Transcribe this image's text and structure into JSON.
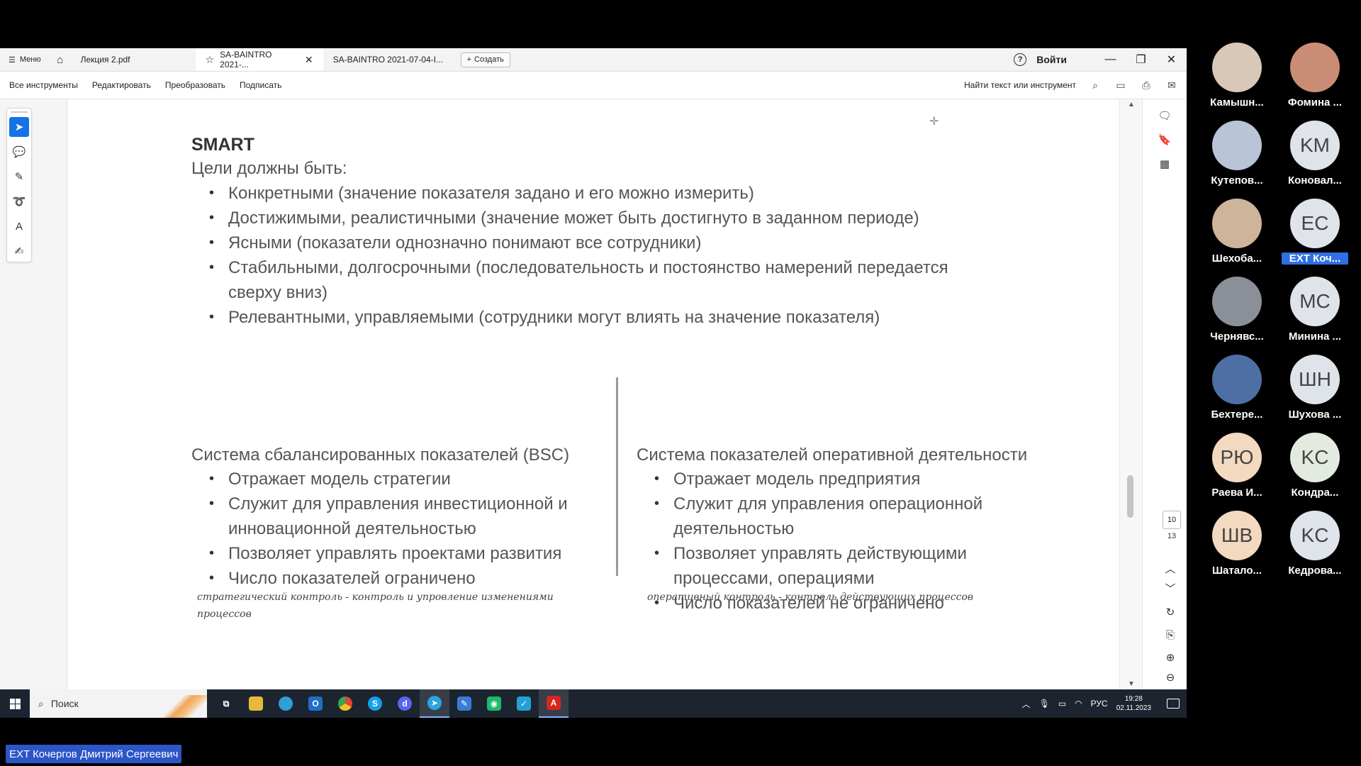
{
  "tabbar": {
    "menu_label": "Меню",
    "tabs": [
      {
        "label": "Лекция 2.pdf"
      },
      {
        "label": "SA-BAINTRO 2021-..."
      },
      {
        "label": "SA-BAINTRO 2021-07-04-I..."
      }
    ],
    "new_label": "Создать",
    "login_label": "Войти"
  },
  "menubar": {
    "items": [
      "Все инструменты",
      "Редактировать",
      "Преобразовать",
      "Подписать"
    ],
    "search_label": "Найти текст или инструмент"
  },
  "document": {
    "smart_title": "SMART",
    "goals_intro": "Цели должны быть:",
    "smart_items": [
      "Конкретными (значение показателя задано и его можно измерить)",
      "Достижимыми, реалистичными (значение может быть достигнуто в заданном периоде)",
      "Ясными (показатели однозначно понимают все сотрудники)",
      "Стабильными, долгосрочными (последовательность и постоянство намерений передается сверху вниз)",
      "Релевантными, управляемыми (сотрудники могут влиять на значение показателя)"
    ],
    "bsc_title": "Система сбалансированных показателей (BSC)",
    "bsc_items": [
      "Отражает модель стратегии",
      "Служит для управления инвестиционной и инновационной деятельностью",
      "Позволяет управлять проектами развития",
      "Число показателей ограничено"
    ],
    "ops_title": "Система показателей оперативной деятельности",
    "ops_items": [
      "Отражает модель предприятия",
      "Служит для управления операционной деятельностью",
      "Позволяет управлять действующими процессами, операциями",
      "Число показателей не ограничено"
    ],
    "bsc_note": "стратегический контроль - контроль и упровление изменениями процессов",
    "ops_note": "оперативный контроль - контроль действующих процессов"
  },
  "pagenav": {
    "current": "10",
    "total": "13"
  },
  "taskbar": {
    "search_label": "Поиск",
    "lang": "РУС",
    "time": "19:28",
    "date": "02.11.2023"
  },
  "participants": [
    {
      "name": "Камышн...",
      "initials": "",
      "bg": "#d9c7b8"
    },
    {
      "name": "Фомина ...",
      "initials": "",
      "bg": "#c98d76"
    },
    {
      "name": "Кутепов...",
      "initials": "",
      "bg": "#b9c4d6"
    },
    {
      "name": "Коновал...",
      "initials": "KM",
      "bg": "#dfe3ea"
    },
    {
      "name": "Шехоба...",
      "initials": "",
      "bg": "#cdb49a"
    },
    {
      "name": "EXT Коч...",
      "initials": "EC",
      "bg": "#dfe3ea"
    },
    {
      "name": "Чернявс...",
      "initials": "",
      "bg": "#8a8f98"
    },
    {
      "name": "Минина ...",
      "initials": "MC",
      "bg": "#dfe3ea"
    },
    {
      "name": "Бехтере...",
      "initials": "",
      "bg": "#4e6fa3"
    },
    {
      "name": "Шухова ...",
      "initials": "ШН",
      "bg": "#dfe3ea"
    },
    {
      "name": "Раева И...",
      "initials": "РЮ",
      "bg": "#f3d9bf"
    },
    {
      "name": "Кондра...",
      "initials": "KC",
      "bg": "#e3eadf"
    },
    {
      "name": "Шатало...",
      "initials": "ШВ",
      "bg": "#f3d9bf"
    },
    {
      "name": "Кедрова...",
      "initials": "KC",
      "bg": "#dfe3ea"
    }
  ],
  "speaker_label": "EXT Кочергов Дмитрий Сергеевич"
}
